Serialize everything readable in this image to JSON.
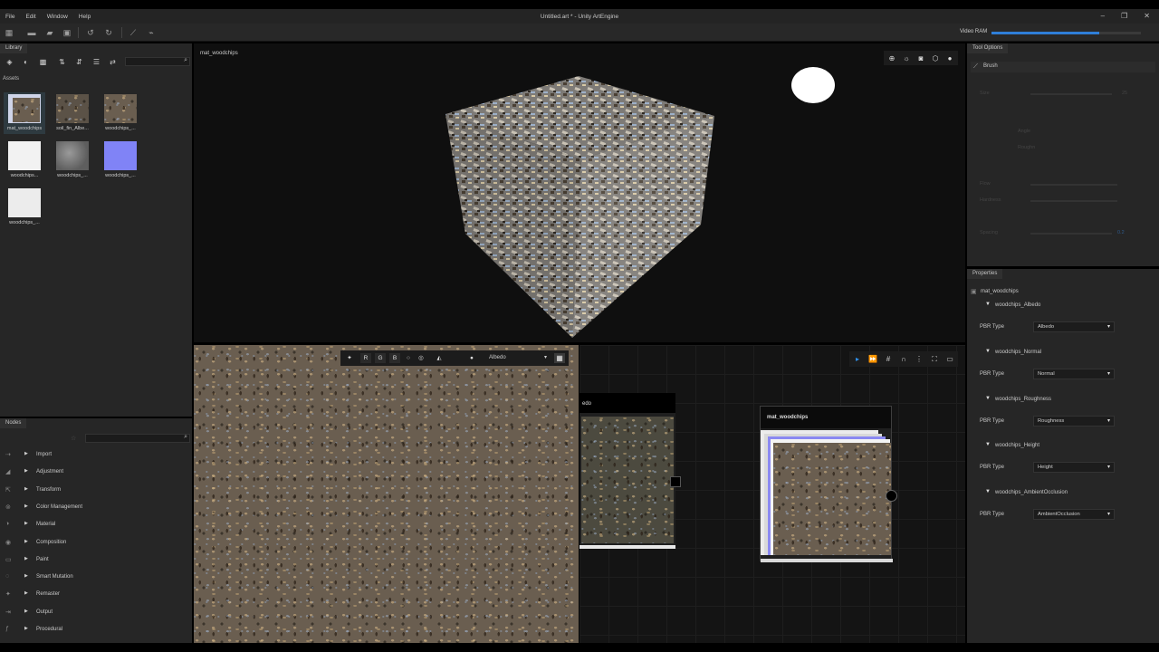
{
  "menubar": {
    "items": [
      "File",
      "Edit",
      "Window",
      "Help"
    ],
    "title": "Untitled.art * - Unity ArtEngine",
    "controls": [
      "minimize-icon",
      "restore-icon",
      "close-icon"
    ]
  },
  "toolbar": {
    "video_ram_label": "Video RAM",
    "video_ram_fraction": 0.72,
    "accent": "#2f7fd8"
  },
  "library": {
    "tab": "Library",
    "assets_label": "Assets",
    "assets": [
      {
        "name": "mat_woodchips",
        "kind": "material"
      },
      {
        "name": "soil_fin_Albe...",
        "kind": "albedo"
      },
      {
        "name": "woodchips_...",
        "kind": "albedo"
      },
      {
        "name": "woodchips...",
        "kind": "white"
      },
      {
        "name": "woodchips_...",
        "kind": "roughness"
      },
      {
        "name": "woodchips_...",
        "kind": "normal"
      },
      {
        "name": "woodchips_...",
        "kind": "white"
      }
    ]
  },
  "nodes": {
    "tab": "Nodes",
    "categories": [
      "Import",
      "Adjustment",
      "Transform",
      "Color Management",
      "Material",
      "Composition",
      "Paint",
      "Smart Mutation",
      "Remaster",
      "Output",
      "Procedural"
    ]
  },
  "viewport": {
    "label": "mat_woodchips"
  },
  "view2d": {
    "channels": [
      "R",
      "G",
      "B"
    ],
    "selected": "Albedo"
  },
  "graph": {
    "node1_label": "edo",
    "node2_label": "mat_woodchips"
  },
  "tool_options": {
    "tab": "Tool Options",
    "brush_label": "Brush",
    "size_label": "Size",
    "size_value": "25",
    "angle_label": "Angle",
    "rough_label": "Roughn",
    "flow_label": "Flow",
    "hardness_label": "Hardness",
    "spacing_label": "Spacing",
    "spacing_value": "0.2"
  },
  "properties": {
    "tab": "Properties",
    "material": "mat_woodchips",
    "pbr_label": "PBR Type",
    "textures": [
      {
        "name": "woodchips_Albedo",
        "type": "Albedo"
      },
      {
        "name": "woodchips_Normal",
        "type": "Normal"
      },
      {
        "name": "woodchips_Roughness",
        "type": "Roughness"
      },
      {
        "name": "woodchips_Height",
        "type": "Height"
      },
      {
        "name": "woodchips_AmbientOcclusion",
        "type": "AmbientOcclusion"
      }
    ]
  }
}
